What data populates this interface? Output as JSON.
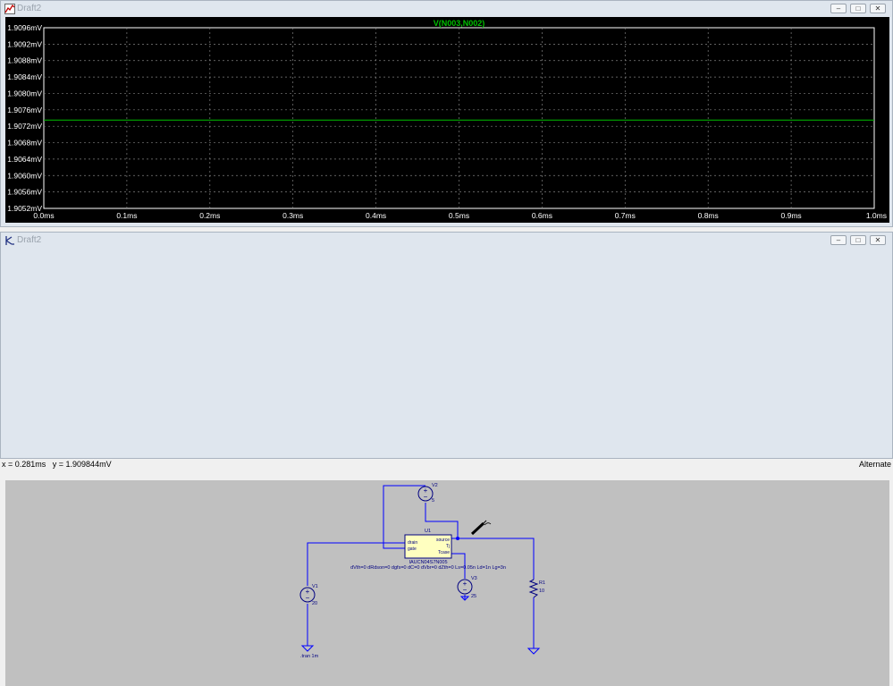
{
  "plot_window": {
    "title": "Draft2",
    "buttons": {
      "minimize": "–",
      "restore": "□",
      "close": "✕"
    }
  },
  "schematic_window": {
    "title": "Draft2",
    "buttons": {
      "minimize": "–",
      "restore": "□",
      "close": "✕"
    }
  },
  "chart_data": {
    "type": "line",
    "title": "V(N003,N002)",
    "xlabel": "",
    "ylabel": "",
    "x_ticks": [
      "0.0ms",
      "0.1ms",
      "0.2ms",
      "0.3ms",
      "0.4ms",
      "0.5ms",
      "0.6ms",
      "0.7ms",
      "0.8ms",
      "0.9ms",
      "1.0ms"
    ],
    "y_ticks": [
      "1.9096mV",
      "1.9092mV",
      "1.9088mV",
      "1.9084mV",
      "1.9080mV",
      "1.9076mV",
      "1.9072mV",
      "1.9068mV",
      "1.9064mV",
      "1.9060mV",
      "1.9056mV",
      "1.9052mV"
    ],
    "xlim": [
      0.0,
      1.0
    ],
    "ylim": [
      1.9052,
      1.9096
    ],
    "x_unit": "ms",
    "y_unit": "mV",
    "grid": true,
    "series": [
      {
        "name": "V(N003,N002)",
        "color": "#00c000",
        "x": [
          0.0,
          1.0
        ],
        "values": [
          1.90735,
          1.90735
        ]
      }
    ],
    "colors": {
      "background": "#000000",
      "grid": "#808080",
      "axis_text": "#ffffff",
      "trace": "#00c000"
    }
  },
  "schematic": {
    "components": {
      "u1": {
        "ref": "U1",
        "part": "IAUCN04S7N005",
        "params": "dVth=0 dRdson=0 dgfs=0 dC=0 dVbr=0 dZth=0 Ls=0.05n Ld=1n Lg=3n",
        "pins": [
          "drain",
          "gate",
          "source",
          "Tj",
          "Tcase"
        ]
      },
      "v1": {
        "ref": "V1",
        "value": "20"
      },
      "v2": {
        "ref": "V2",
        "value": "5"
      },
      "v3": {
        "ref": "V3",
        "value": "25"
      },
      "r1": {
        "ref": "R1",
        "value": "10"
      }
    },
    "directive": ".tran 1m",
    "colors": {
      "wire": "#0000ff",
      "component": "#000080",
      "background": "#c0c0c0",
      "ic_fill": "#ffffc0"
    }
  },
  "status_bar": {
    "cursor": "x = 0.281ms   y = 1.909844mV",
    "mode": "Alternate"
  }
}
